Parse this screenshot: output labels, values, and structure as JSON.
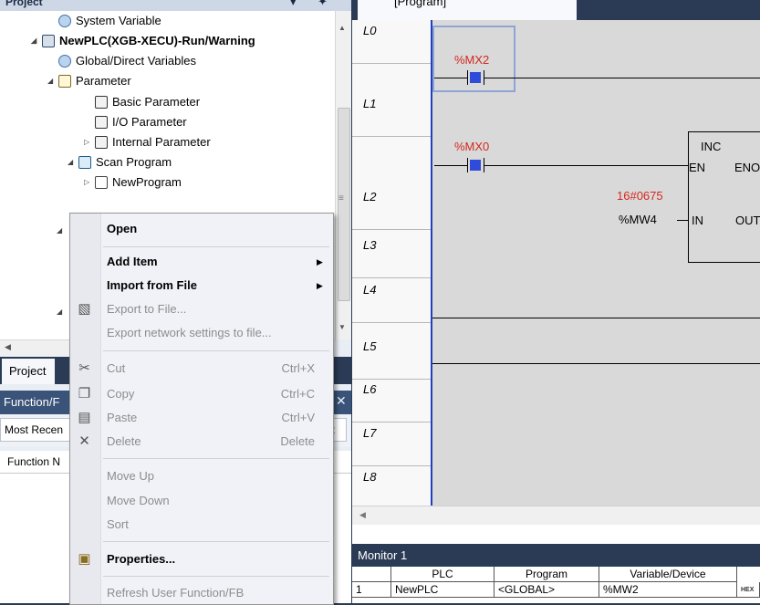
{
  "project_panel": {
    "title": "Project",
    "title_controls": "▾ ✦ ×",
    "tree": {
      "system_variable": "System Variable",
      "plc": "NewPLC(XGB-XECU)-Run/Warning",
      "global_vars": "Global/Direct Variables",
      "parameter": "Parameter",
      "basic_parameter": "Basic Parameter",
      "io_parameter": "I/O Parameter",
      "internal_parameter": "Internal Parameter",
      "scan_program": "Scan Program",
      "new_program": "NewProgram"
    },
    "tab_project": "Project"
  },
  "function_panel": {
    "title": "Function/F",
    "recent_tab": "Most Recen",
    "search_stub": "it",
    "column_name": "Function N"
  },
  "context_menu": {
    "items": {
      "open": "Open",
      "add_item": "Add Item",
      "import_from_file": "Import from File",
      "export_to_file": "Export to File...",
      "export_network": "Export network settings to file...",
      "cut": "Cut",
      "cut_shortcut": "Ctrl+X",
      "copy": "Copy",
      "copy_shortcut": "Ctrl+C",
      "paste": "Paste",
      "paste_shortcut": "Ctrl+V",
      "delete": "Delete",
      "delete_shortcut": "Delete",
      "move_up": "Move Up",
      "move_down": "Move Down",
      "sort": "Sort",
      "properties": "Properties...",
      "refresh_user_fb": "Refresh User Function/FB"
    }
  },
  "editor": {
    "tab_title": "[Program]",
    "rows": [
      "L0",
      "L1",
      "L2",
      "L3",
      "L4",
      "L5",
      "L6",
      "L7",
      "L8"
    ],
    "ladder": {
      "contact_l0": "%MX2",
      "contact_l1": "%MX0",
      "const_value": "16#0675",
      "input_var": "%MW4",
      "fb_name": "INC",
      "pin_en": "EN",
      "pin_eno": "ENO",
      "pin_in": "IN",
      "pin_out": "OUT"
    }
  },
  "monitor": {
    "title": "Monitor 1",
    "columns": [
      "PLC",
      "Program",
      "Variable/Device"
    ],
    "rows": [
      {
        "index": "1",
        "plc": "NewPLC",
        "program": "<GLOBAL>",
        "variable": "%MW2",
        "format_badge": "HEX"
      }
    ]
  },
  "colors": {
    "chrome": "#2b3b55",
    "rung_rail": "#1f3fbf",
    "contact": "#2f4bd9",
    "variable_red": "#d4281e"
  }
}
